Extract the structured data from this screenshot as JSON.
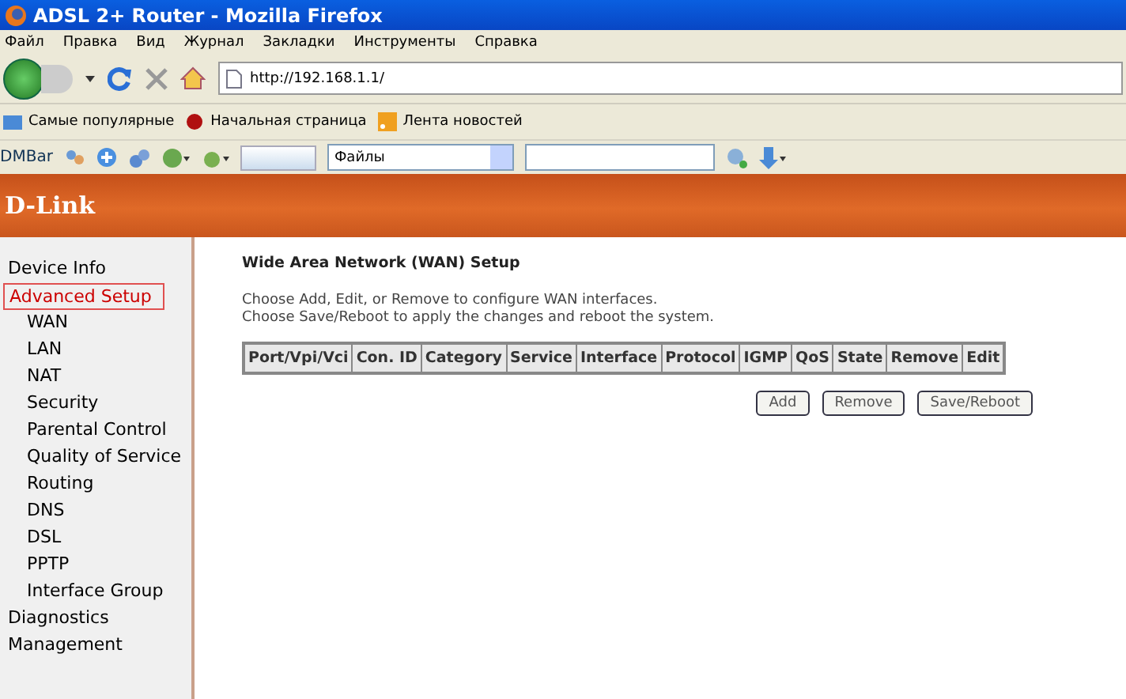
{
  "window": {
    "title": "ADSL 2+ Router - Mozilla Firefox"
  },
  "menu": [
    "Файл",
    "Правка",
    "Вид",
    "Журнал",
    "Закладки",
    "Инструменты",
    "Справка"
  ],
  "address": {
    "value": "http://192.168.1.1/"
  },
  "bookmarks": [
    "Самые популярные",
    "Начальная страница",
    "Лента новостей"
  ],
  "addon_toolbar": {
    "label": "DMBar",
    "dropdown": "Файлы"
  },
  "header": {
    "logo": "D-Link"
  },
  "sidebar": {
    "items": [
      {
        "label": "Device Info",
        "selected": false
      },
      {
        "label": "Advanced Setup",
        "selected": true,
        "children": [
          {
            "label": "WAN",
            "selected": false
          },
          {
            "label": "LAN",
            "selected": false
          },
          {
            "label": "NAT",
            "selected": false
          },
          {
            "label": "Security",
            "selected": false
          },
          {
            "label": "Parental Control",
            "selected": false
          },
          {
            "label": "Quality of Service",
            "selected": false
          },
          {
            "label": "Routing",
            "selected": false
          },
          {
            "label": "DNS",
            "selected": false
          },
          {
            "label": "DSL",
            "selected": false
          },
          {
            "label": "PPTP",
            "selected": false
          },
          {
            "label": "Interface Group",
            "selected": false
          }
        ]
      },
      {
        "label": "Diagnostics",
        "selected": false
      },
      {
        "label": "Management",
        "selected": false
      }
    ]
  },
  "content": {
    "title": "Wide Area Network (WAN) Setup",
    "instructions": [
      "Choose Add, Edit, or Remove to configure WAN interfaces.",
      "Choose Save/Reboot to apply the changes and reboot the system."
    ],
    "table": {
      "columns": [
        "Port/Vpi/Vci",
        "Con. ID",
        "Category",
        "Service",
        "Interface",
        "Protocol",
        "IGMP",
        "QoS",
        "State",
        "Remove",
        "Edit"
      ]
    },
    "buttons": [
      "Add",
      "Remove",
      "Save/Reboot"
    ]
  }
}
